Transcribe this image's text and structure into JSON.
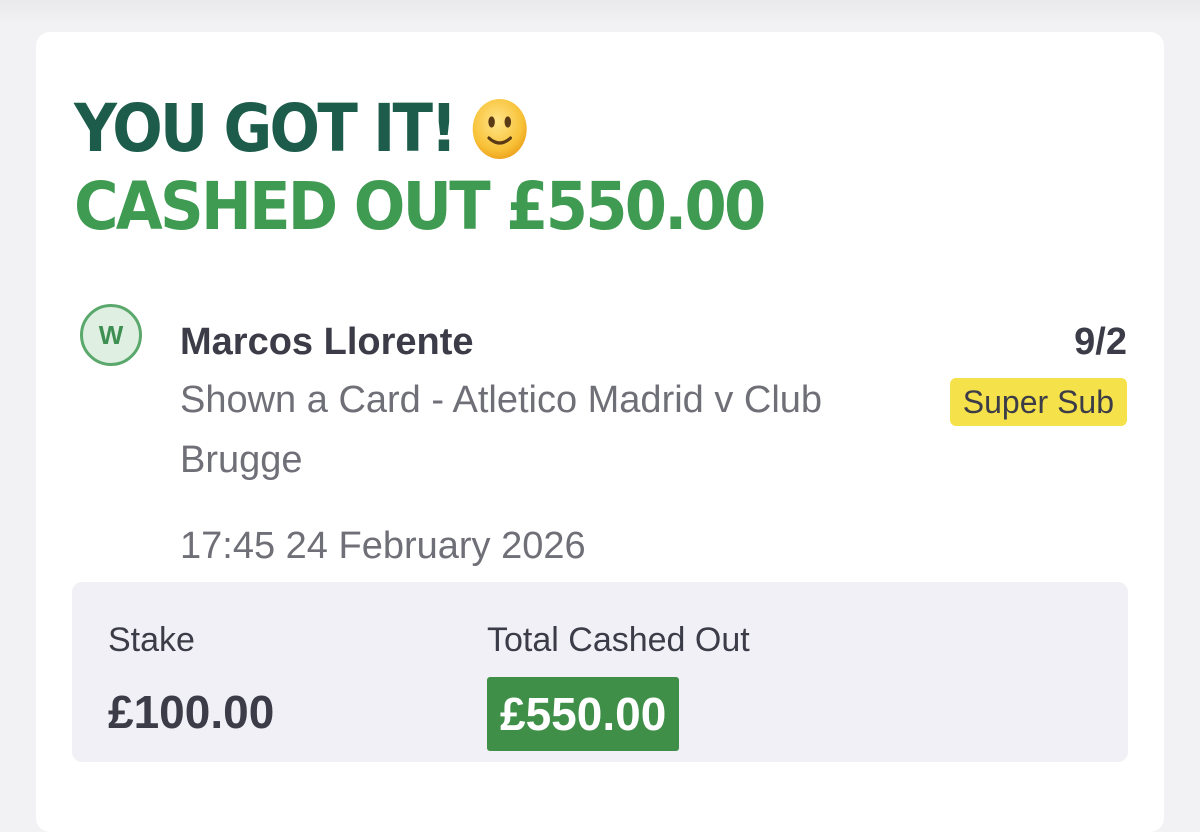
{
  "header": {
    "headline": "YOU GOT IT!",
    "emoji_icon": "slightly-smiling-face-icon",
    "cashed_out_text": "CASHED OUT £550.00"
  },
  "selection": {
    "status_letter": "W",
    "name": "Marcos Llorente",
    "market": "Shown a Card - Atletico Madrid v Club Brugge",
    "datetime": "17:45 24 February 2026",
    "odds": "9/2",
    "badge": "Super Sub"
  },
  "summary": {
    "stake_label": "Stake",
    "stake_value": "£100.00",
    "cashed_out_label": "Total Cashed Out",
    "cashed_out_value": "£550.00"
  },
  "colors": {
    "headline_dark_green": "#1d5c4a",
    "headline_green": "#3f9a52",
    "badge_yellow": "#f5e24a",
    "cashed_out_green": "#3f8f49",
    "panel_background": "#f0f0f6"
  }
}
